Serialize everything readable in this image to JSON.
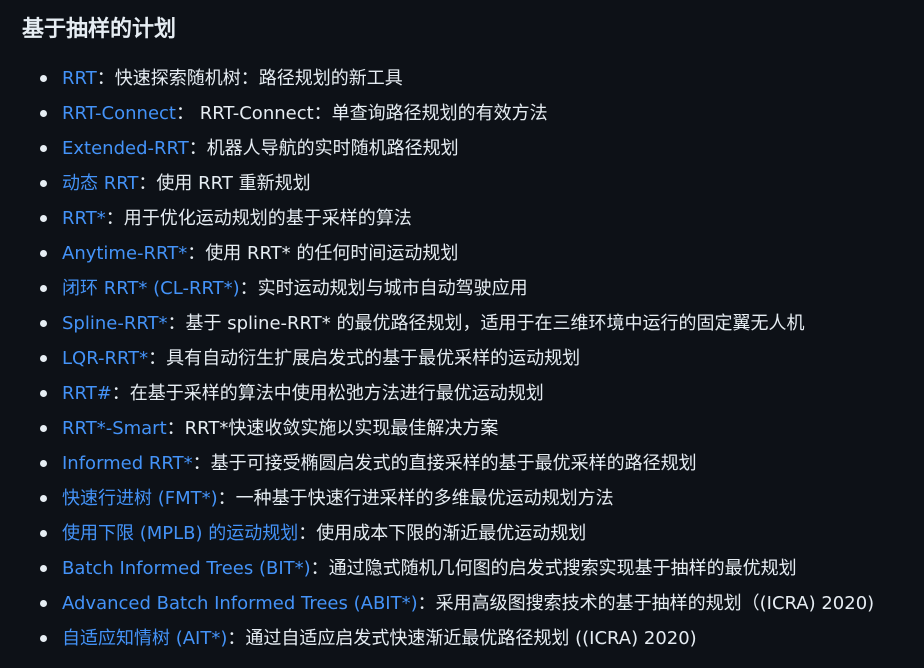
{
  "heading": "基于抽样的计划",
  "items": [
    {
      "link": "RRT",
      "sep": "：",
      "desc": "快速探索随机树：路径规划的新工具"
    },
    {
      "link": "RRT-Connect",
      "sep": "：",
      "desc": " RRT-Connect：单查询路径规划的有效方法"
    },
    {
      "link": "Extended-RRT",
      "sep": "：",
      "desc": "机器人导航的实时随机路径规划"
    },
    {
      "link": "动态 RRT",
      "sep": "：",
      "desc": "使用 RRT 重新规划"
    },
    {
      "link": "RRT*",
      "sep": "：",
      "desc": "用于优化运动规划的基于采样的算法"
    },
    {
      "link": "Anytime-RRT*",
      "sep": "：",
      "desc": "使用 RRT* 的任何时间运动规划"
    },
    {
      "link": "闭环 RRT* (CL-RRT*)",
      "sep": "：",
      "desc": "实时运动规划与城市自动驾驶应用"
    },
    {
      "link": "Spline-RRT*",
      "sep": "：",
      "desc": "基于 spline-RRT* 的最优路径规划，适用于在三维环境中运行的固定翼无人机"
    },
    {
      "link": "LQR-RRT*",
      "sep": "：",
      "desc": "具有自动衍生扩展启发式的基于最优采样的运动规划"
    },
    {
      "link": "RRT#",
      "sep": "：",
      "desc": "在基于采样的算法中使用松弛方法进行最优运动规划"
    },
    {
      "link": "RRT*-Smart",
      "sep": "：",
      "desc": "RRT*快速收敛实施以实现最佳解决方案"
    },
    {
      "link": "Informed RRT*",
      "sep": "：",
      "desc": "基于可接受椭圆启发式的直接采样的基于最优采样的路径规划"
    },
    {
      "link": "快速行进树 (FMT*)",
      "sep": "：",
      "desc": "一种基于快速行进采样的多维最优运动规划方法"
    },
    {
      "link": "使用下限 (MPLB) 的运动规划",
      "sep": "：",
      "desc": "使用成本下限的渐近最优运动规划"
    },
    {
      "link": "Batch Informed Trees (BIT*)",
      "sep": "：",
      "desc": "通过隐式随机几何图的启发式搜索实现基于抽样的最优规划"
    },
    {
      "link": "Advanced Batch Informed Trees (ABIT*)",
      "sep": "：",
      "desc": "采用高级图搜索技术的基于抽样的规划（(ICRA) 2020)"
    },
    {
      "link": "自适应知情树 (AIT*)",
      "sep": "：",
      "desc": "通过自适应启发式快速渐近最优路径规划 ((ICRA) 2020)"
    }
  ]
}
